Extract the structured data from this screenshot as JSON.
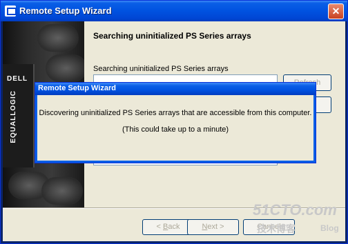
{
  "window": {
    "title": "Remote Setup Wizard"
  },
  "banner": {
    "brand": "DELL",
    "product": "EQUALLOGIC"
  },
  "page": {
    "heading": "Searching uninitialized PS Series arrays",
    "list_label": "Searching uninitialized PS Series arrays",
    "side_button_1": "Refresh",
    "side_button_2": ""
  },
  "nav": {
    "back_prefix": "< ",
    "back_key": "B",
    "back_rest": "ack",
    "next_key": "N",
    "next_rest": "ext >",
    "cancel": "Cancel"
  },
  "dialog": {
    "title": "Remote Setup Wizard",
    "message": "Discovering uninitialized PS Series arrays that are accessible from this computer.",
    "note": "(This could take up to a minute)"
  },
  "watermark": {
    "site": "51CTO.com",
    "cn": "技术博客",
    "blog": "Blog"
  }
}
